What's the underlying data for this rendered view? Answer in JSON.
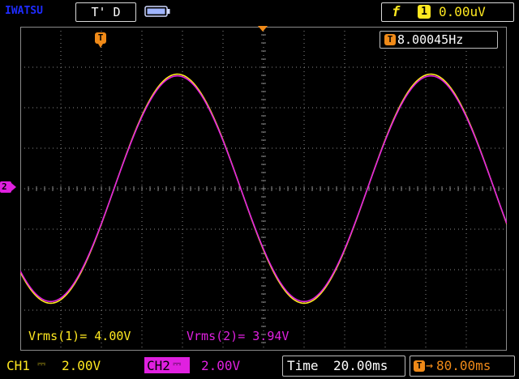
{
  "header": {
    "brand": "IWATSU",
    "mode": "T' D",
    "trigger": {
      "edge_symbol": "f",
      "source": "1",
      "level": "0.00uV"
    }
  },
  "display": {
    "frequency": "8.00045Hz",
    "trigger_marker": "T",
    "channel_marker": "2",
    "measurements": {
      "vrms1": "Vrms(1)= 4.00V",
      "vrms2": "Vrms(2)= 3.94V"
    }
  },
  "footer": {
    "ch1": {
      "label": "CH1",
      "coupling": "⎓",
      "scale": "2.00V"
    },
    "ch2": {
      "label": "CH2",
      "coupling": "⎓",
      "scale": "2.00V"
    },
    "time": {
      "label": "Time",
      "value": "20.00ms"
    },
    "position": {
      "marker": "T",
      "arrow": "→",
      "value": "80.00ms"
    }
  },
  "colors": {
    "ch1": "#ffe820",
    "ch2": "#e020e0",
    "trigger": "#f08a18",
    "grid": "#8a8a8a",
    "brand": "#1f2cff"
  },
  "chart_data": {
    "type": "line",
    "time_per_div_ms": 20,
    "volts_per_div": 2,
    "divisions": {
      "x": 12,
      "y": 8
    },
    "grid": true,
    "series": [
      {
        "name": "CH1",
        "waveform": "sine",
        "frequency_hz": 8.00045,
        "vrms": 4.0
      },
      {
        "name": "CH2",
        "waveform": "sine",
        "frequency_hz": 8.00045,
        "vrms": 3.94
      }
    ]
  }
}
